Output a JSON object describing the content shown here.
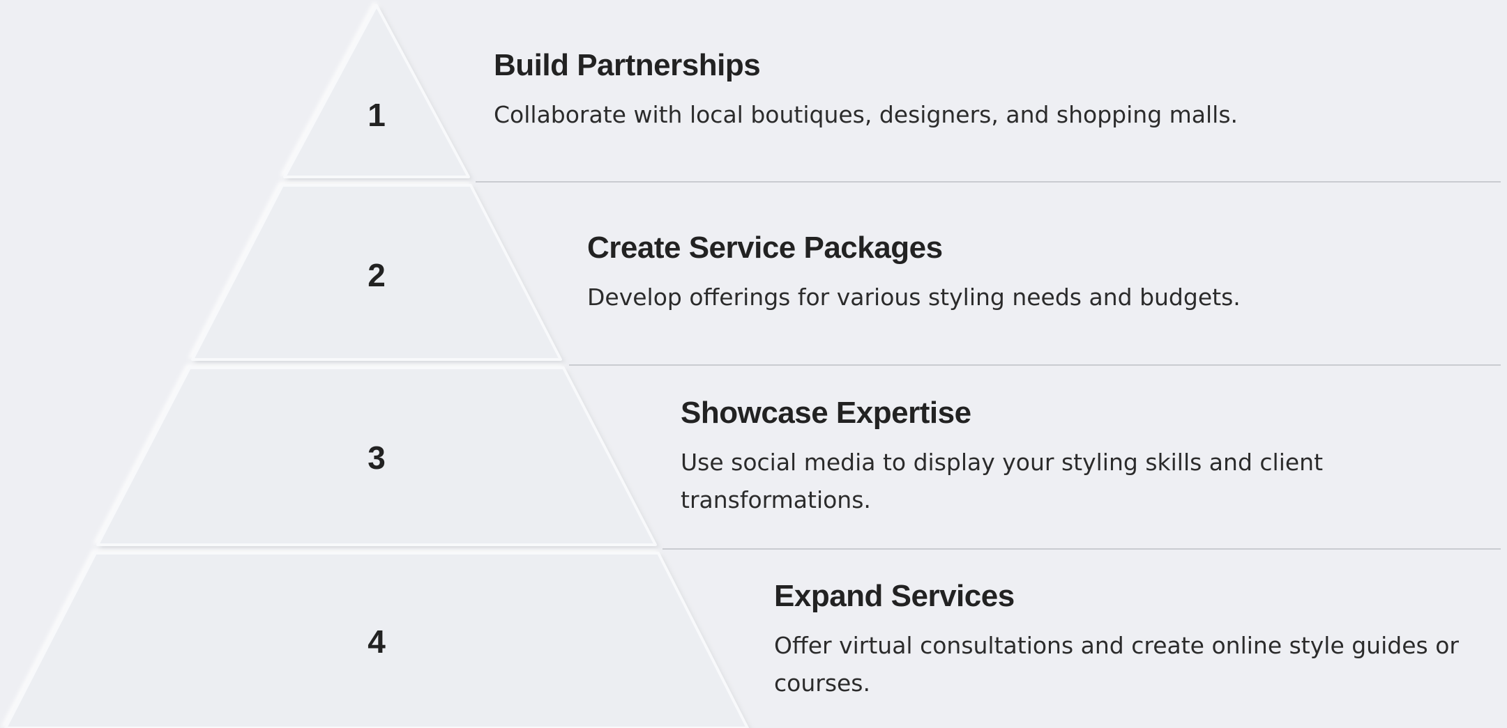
{
  "colors": {
    "background": "#eeeff3",
    "tier_fill": "#eceef2",
    "tier_edge_light": "#fbfcfe",
    "tier_edge_shadow": "#dcdee3",
    "divider": "#c9cbd0",
    "text": "#222222"
  },
  "steps": [
    {
      "number": "1",
      "title": "Build Partnerships",
      "description": "Collaborate with local boutiques, designers, and shopping malls."
    },
    {
      "number": "2",
      "title": "Create Service Packages",
      "description": "Develop offerings for various styling needs and budgets."
    },
    {
      "number": "3",
      "title": "Showcase Expertise",
      "description": "Use social media to display your styling skills and client transformations."
    },
    {
      "number": "4",
      "title": "Expand Services",
      "description": "Offer virtual consultations and create online style guides or courses."
    }
  ]
}
